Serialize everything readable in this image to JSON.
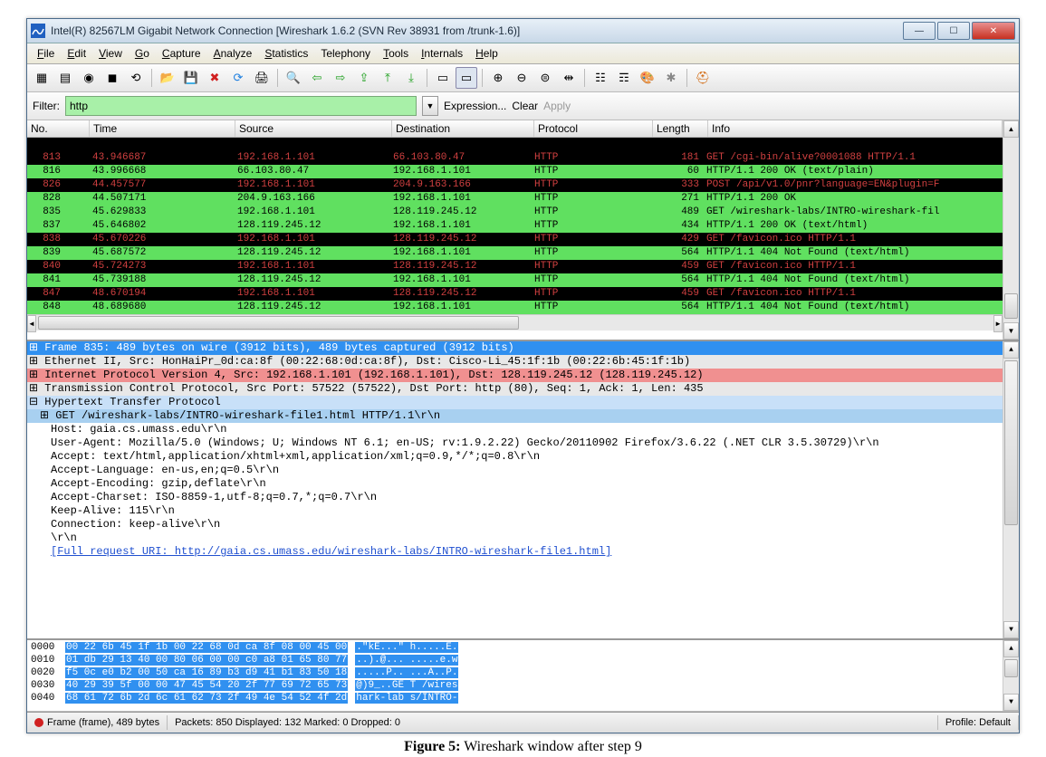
{
  "window": {
    "title": "Intel(R) 82567LM Gigabit Network Connection   [Wireshark 1.6.2  (SVN Rev 38931 from /trunk-1.6)]"
  },
  "menu": {
    "file": "File",
    "edit": "Edit",
    "view": "View",
    "go": "Go",
    "capture": "Capture",
    "analyze": "Analyze",
    "statistics": "Statistics",
    "telephony": "Telephony",
    "tools": "Tools",
    "internals": "Internals",
    "help": "Help"
  },
  "filter": {
    "label": "Filter:",
    "value": "http",
    "expression": "Expression...",
    "clear": "Clear",
    "apply": "Apply"
  },
  "columns": {
    "no": "No.",
    "time": "Time",
    "src": "Source",
    "dst": "Destination",
    "proto": "Protocol",
    "len": "Length",
    "info": "Info"
  },
  "packets": [
    {
      "no": "813",
      "time": "43.946687",
      "src": "192.168.1.101",
      "dst": "66.103.80.47",
      "proto": "HTTP",
      "len": "181",
      "info": "GET /cgi-bin/alive?0001088 HTTP/1.1",
      "cls": "black"
    },
    {
      "no": "816",
      "time": "43.996668",
      "src": "66.103.80.47",
      "dst": "192.168.1.101",
      "proto": "HTTP",
      "len": "60",
      "info": "HTTP/1.1 200 OK  (text/plain)",
      "cls": "green"
    },
    {
      "no": "826",
      "time": "44.457577",
      "src": "192.168.1.101",
      "dst": "204.9.163.166",
      "proto": "HTTP",
      "len": "333",
      "info": "POST /api/v1.0/pnr?language=EN&plugin=F",
      "cls": "black"
    },
    {
      "no": "828",
      "time": "44.507171",
      "src": "204.9.163.166",
      "dst": "192.168.1.101",
      "proto": "HTTP",
      "len": "271",
      "info": "HTTP/1.1 200 OK",
      "cls": "green"
    },
    {
      "no": "835",
      "time": "45.629833",
      "src": "192.168.1.101",
      "dst": "128.119.245.12",
      "proto": "HTTP",
      "len": "489",
      "info": "GET /wireshark-labs/INTRO-wireshark-fil",
      "cls": "green"
    },
    {
      "no": "837",
      "time": "45.646802",
      "src": "128.119.245.12",
      "dst": "192.168.1.101",
      "proto": "HTTP",
      "len": "434",
      "info": "HTTP/1.1 200 OK  (text/html)",
      "cls": "green"
    },
    {
      "no": "838",
      "time": "45.670226",
      "src": "192.168.1.101",
      "dst": "128.119.245.12",
      "proto": "HTTP",
      "len": "429",
      "info": "GET /favicon.ico HTTP/1.1",
      "cls": "black"
    },
    {
      "no": "839",
      "time": "45.687572",
      "src": "128.119.245.12",
      "dst": "192.168.1.101",
      "proto": "HTTP",
      "len": "564",
      "info": "HTTP/1.1 404 Not Found  (text/html)",
      "cls": "green"
    },
    {
      "no": "840",
      "time": "45.724273",
      "src": "192.168.1.101",
      "dst": "128.119.245.12",
      "proto": "HTTP",
      "len": "459",
      "info": "GET /favicon.ico HTTP/1.1",
      "cls": "black"
    },
    {
      "no": "841",
      "time": "45.739188",
      "src": "128.119.245.12",
      "dst": "192.168.1.101",
      "proto": "HTTP",
      "len": "564",
      "info": "HTTP/1.1 404 Not Found  (text/html)",
      "cls": "green"
    },
    {
      "no": "847",
      "time": "48.670194",
      "src": "192.168.1.101",
      "dst": "128.119.245.12",
      "proto": "HTTP",
      "len": "459",
      "info": "GET /favicon.ico HTTP/1.1",
      "cls": "black"
    },
    {
      "no": "848",
      "time": "48.689680",
      "src": "128.119.245.12",
      "dst": "192.168.1.101",
      "proto": "HTTP",
      "len": "564",
      "info": "HTTP/1.1 404 Not Found  (text/html)",
      "cls": "green"
    }
  ],
  "details": {
    "frame": "⊞ Frame 835: 489 bytes on wire (3912 bits), 489 bytes captured (3912 bits)",
    "eth": "⊞ Ethernet II, Src: HonHaiPr_0d:ca:8f (00:22:68:0d:ca:8f), Dst: Cisco-Li_45:1f:1b (00:22:6b:45:1f:1b)",
    "ip": "⊞ Internet Protocol Version 4, Src: 192.168.1.101 (192.168.1.101), Dst: 128.119.245.12 (128.119.245.12)",
    "tcp": "⊞ Transmission Control Protocol, Src Port: 57522 (57522), Dst Port: http (80), Seq: 1, Ack: 1, Len: 435",
    "http": "⊟ Hypertext Transfer Protocol",
    "get": "⊞ GET /wireshark-labs/INTRO-wireshark-file1.html HTTP/1.1\\r\\n",
    "host": "Host: gaia.cs.umass.edu\\r\\n",
    "ua": "User-Agent: Mozilla/5.0 (Windows; U; Windows NT 6.1; en-US; rv:1.9.2.22) Gecko/20110902 Firefox/3.6.22 (.NET CLR 3.5.30729)\\r\\n",
    "acc": "Accept: text/html,application/xhtml+xml,application/xml;q=0.9,*/*;q=0.8\\r\\n",
    "accl": "Accept-Language: en-us,en;q=0.5\\r\\n",
    "acce": "Accept-Encoding: gzip,deflate\\r\\n",
    "accc": "Accept-Charset: ISO-8859-1,utf-8;q=0.7,*;q=0.7\\r\\n",
    "ka": "Keep-Alive: 115\\r\\n",
    "conn": "Connection: keep-alive\\r\\n",
    "crlf": "\\r\\n",
    "uri": "[Full request URI: http://gaia.cs.umass.edu/wireshark-labs/INTRO-wireshark-file1.html]"
  },
  "hex": [
    {
      "off": "0000",
      "b": "00 22 6b 45 1f 1b 00 22  68 0d ca 8f 08 00 45 00",
      "a": ".\"kE...\" h.....E."
    },
    {
      "off": "0010",
      "b": "01 db 29 13 40 00 80 06  00 00 c0 a8 01 65 80 77",
      "a": "..).@... .....e.w"
    },
    {
      "off": "0020",
      "b": "f5 0c e0 b2 00 50 ca 16  89 b3 d9 41 b1 83 50 18",
      "a": ".....P.. ...A..P."
    },
    {
      "off": "0030",
      "b": "40 29 39 5f 00 00 47 45  54 20 2f 77 69 72 65 73",
      "a": "@)9_..GE T /wires"
    },
    {
      "off": "0040",
      "b": "68 61 72 6b 2d 6c 61 62  73 2f 49 4e 54 52 4f 2d",
      "a": "hark-lab s/INTRO-"
    }
  ],
  "status": {
    "frame": "Frame (frame), 489 bytes",
    "pkts": "Packets: 850 Displayed: 132 Marked: 0 Dropped: 0",
    "profile": "Profile: Default"
  },
  "caption_bold": "Figure 5:",
  "caption_rest": " Wireshark window after step 9"
}
